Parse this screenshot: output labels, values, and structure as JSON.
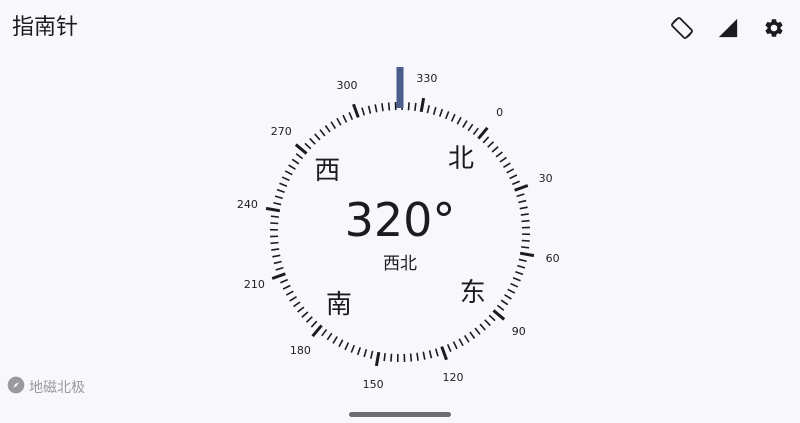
{
  "app": {
    "title": "指南针"
  },
  "toolbar": {
    "rotation_icon": "screen-rotation-icon",
    "signal_icon": "signal-icon",
    "settings_icon": "settings-gear-icon"
  },
  "compass": {
    "heading_text": "320°",
    "heading_degrees": 320,
    "direction_text": "西北",
    "cardinals": {
      "north": "北",
      "east": "东",
      "south": "南",
      "west": "西"
    },
    "degree_labels": [
      "0",
      "30",
      "60",
      "90",
      "120",
      "150",
      "180",
      "210",
      "240",
      "270",
      "300",
      "330"
    ],
    "indicator_color": "#4a5d8c",
    "tick_color": "#1c1b1f"
  },
  "footer": {
    "mode_icon": "compass-icon",
    "mode_label": "地磁北极"
  }
}
